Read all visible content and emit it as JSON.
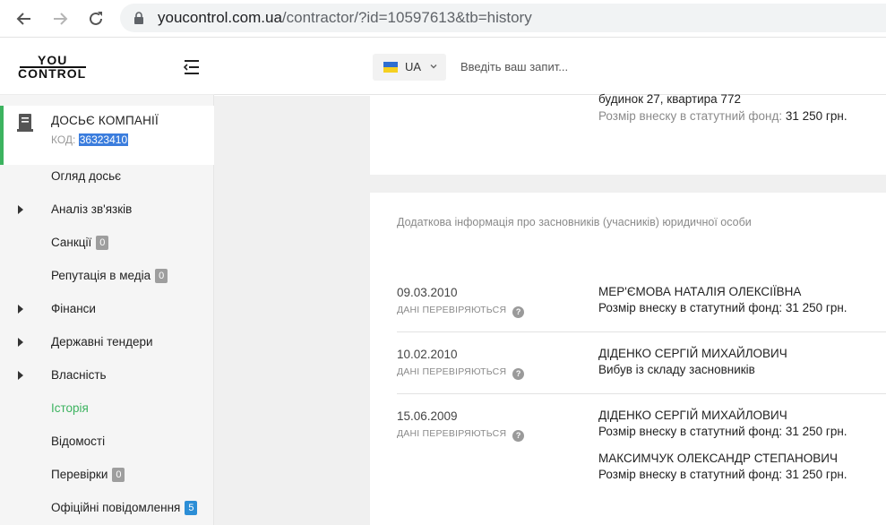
{
  "browser": {
    "url_host": "youcontrol.com.ua",
    "url_path": "/contractor/?id=10597613&tb=history"
  },
  "logo": {
    "top": "YOU",
    "bottom": "CONTROL"
  },
  "company": {
    "title": "ДОСЬЄ КОМПАНІЇ",
    "code_label": "КОД:",
    "code_value": "36323410"
  },
  "sidebar": {
    "items": [
      {
        "label": "Огляд досьє",
        "expandable": false
      },
      {
        "label": "Аналіз зв'язків",
        "expandable": true
      },
      {
        "label": "Санкції",
        "expandable": false,
        "badge": "0"
      },
      {
        "label": "Репутація в медіа",
        "expandable": false,
        "badge": "0"
      },
      {
        "label": "Фінанси",
        "expandable": true
      },
      {
        "label": "Державні тендери",
        "expandable": true
      },
      {
        "label": "Власність",
        "expandable": true
      },
      {
        "label": "Історія",
        "expandable": false,
        "active": true
      },
      {
        "label": "Відомості",
        "expandable": false
      },
      {
        "label": "Перевірки",
        "expandable": false,
        "badge": "0"
      },
      {
        "label": "Офіційні повідомлення",
        "expandable": false,
        "badge": "5"
      }
    ]
  },
  "header": {
    "language": "UA",
    "search_placeholder": "Введіть ваш запит..."
  },
  "card1": {
    "address_tail": "будинок 27, квартира 772",
    "contribution_label": "Розмір внеску в статутний фонд:",
    "contribution_value": "31 250 грн."
  },
  "history": {
    "section_title": "Додаткова інформація про засновників (учасників) юридичної особи",
    "verify_label": "ДАНІ ПЕРЕВІРЯЮТЬСЯ",
    "entries": [
      {
        "date": "09.03.2010",
        "records": [
          {
            "name": "МЕР'ЄМОВА НАТАЛІЯ ОЛЕКСІЇВНА",
            "detail": "Розмір внеску в статутний фонд: 31 250 грн."
          }
        ]
      },
      {
        "date": "10.02.2010",
        "records": [
          {
            "name": "ДІДЕНКО СЕРГІЙ МИХАЙЛОВИЧ",
            "detail": "Вибув із складу засновників"
          }
        ]
      },
      {
        "date": "15.06.2009",
        "records": [
          {
            "name": "ДІДЕНКО СЕРГІЙ МИХАЙЛОВИЧ",
            "detail": "Розмір внеску в статутний фонд: 31 250 грн."
          },
          {
            "name": "МАКСИМЧУК ОЛЕКСАНДР СТЕПАНОВИЧ",
            "detail": "Розмір внеску в статутний фонд: 31 250 грн."
          }
        ]
      }
    ]
  }
}
